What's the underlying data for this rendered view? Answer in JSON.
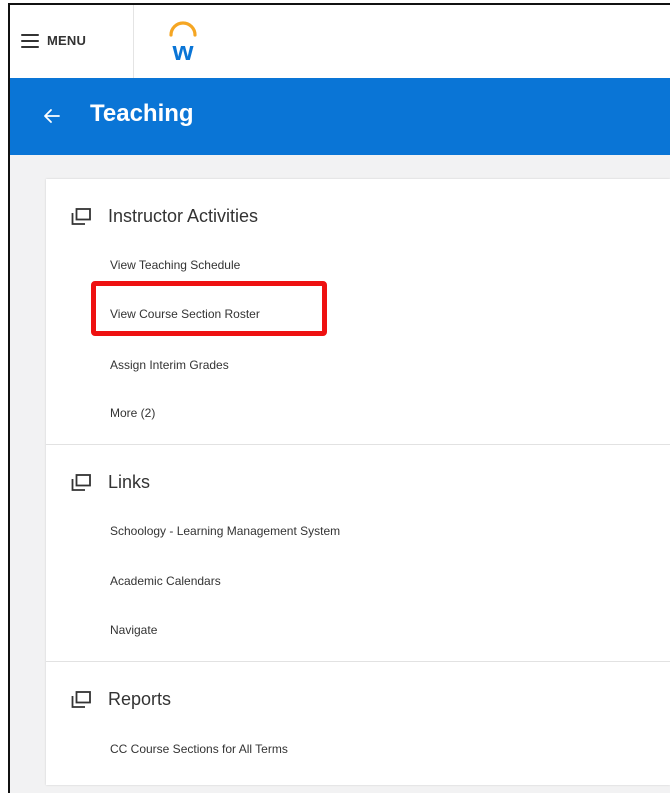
{
  "topbar": {
    "menu_label": "MENU",
    "logo_letter": "w",
    "brand_color": "#0a75d6",
    "logo_arc_color": "#f5a623"
  },
  "header": {
    "title": "Teaching"
  },
  "sections": [
    {
      "title": "Instructor Activities",
      "icon": "stacked-windows-icon",
      "items": [
        "View Teaching Schedule",
        "View Course Section Roster",
        "Assign Interim Grades",
        "More (2)"
      ]
    },
    {
      "title": "Links",
      "icon": "stacked-windows-icon",
      "items": [
        "Schoology - Learning Management System",
        "Academic Calendars",
        "Navigate"
      ]
    },
    {
      "title": "Reports",
      "icon": "stacked-windows-icon",
      "items": [
        "CC Course Sections for All Terms"
      ]
    }
  ],
  "annotation": {
    "highlight_color": "#ee1111"
  }
}
